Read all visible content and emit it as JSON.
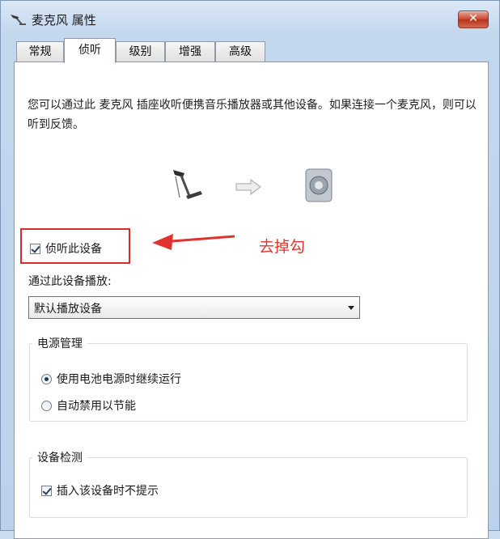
{
  "window": {
    "title": "麦克风 属性",
    "close_label": "✕"
  },
  "tabs": [
    {
      "label": "常规",
      "active": false
    },
    {
      "label": "侦听",
      "active": true
    },
    {
      "label": "级别",
      "active": false
    },
    {
      "label": "增强",
      "active": false
    },
    {
      "label": "高级",
      "active": false
    }
  ],
  "listen": {
    "description": "您可以通过此 麦克风 插座收听便携音乐播放器或其他设备。如果连接一个麦克风，则可以听到反馈。",
    "listen_checkbox_label": "侦听此设备",
    "listen_checked": true,
    "playback_label": "通过此设备播放:",
    "playback_device": "默认播放设备"
  },
  "power": {
    "title": "电源管理",
    "option_continue": "使用电池电源时继续运行",
    "option_disable": "自动禁用以节能",
    "selected": "continue"
  },
  "detection": {
    "title": "设备检测",
    "no_prompt_label": "插入该设备时不提示",
    "checked": true
  },
  "annotation": {
    "text": "去掉勾",
    "color": "#e0332f"
  },
  "colors": {
    "highlight": "#d42b2b",
    "titlebar": "#c3d7ee"
  }
}
